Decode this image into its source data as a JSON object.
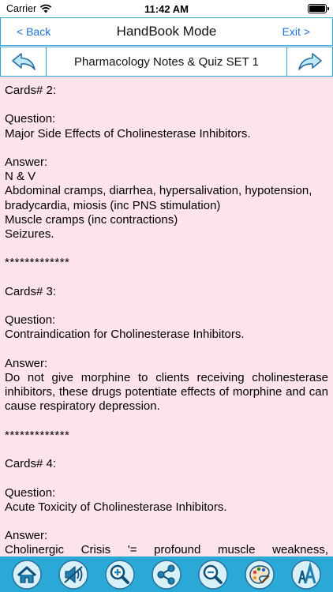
{
  "status": {
    "carrier": "Carrier",
    "time": "11:42 AM",
    "battery_level": 1.0
  },
  "nav": {
    "back_label": "< Back",
    "title": "HandBook Mode",
    "exit_label": "Exit >"
  },
  "set": {
    "title": "Pharmacology Notes & Quiz SET 1"
  },
  "cards": [
    {
      "header": "Cards# 2:",
      "question_label": "Question:",
      "question": "Major Side Effects of Cholinesterase Inhibitors.",
      "answer_label": "Answer:",
      "answer_lines": [
        "N & V",
        "Abdominal cramps, diarrhea, hypersalivation, hypotension, bradycardia, miosis (inc PNS stimulation)",
        "Muscle cramps (inc contractions)",
        "Seizures."
      ],
      "separator": "*************"
    },
    {
      "header": "Cards# 3:",
      "question_label": "Question:",
      "question": "Contraindication for Cholinesterase Inhibitors.",
      "answer_label": "Answer:",
      "answer_lines": [
        "Do not give morphine to clients receiving cholinesterase inhibitors, these drugs potentiate effects of morphine and can cause respiratory depression."
      ],
      "separator": "*************"
    },
    {
      "header": "Cards# 4:",
      "question_label": "Question:",
      "question": "Acute Toxicity of Cholinesterase Inhibitors.",
      "answer_label": "Answer:",
      "answer_lines": [
        "Cholinergic Crisis '= profound muscle weakness,"
      ]
    }
  ],
  "toolbar": {
    "icons": [
      "home-icon",
      "speaker-mute-icon",
      "zoom-in-icon",
      "share-icon",
      "zoom-out-icon",
      "palette-icon",
      "font-size-icon"
    ]
  },
  "colors": {
    "accent": "#2aa8d6",
    "link": "#1f6fd6",
    "content_bg": "#fde3ea"
  }
}
